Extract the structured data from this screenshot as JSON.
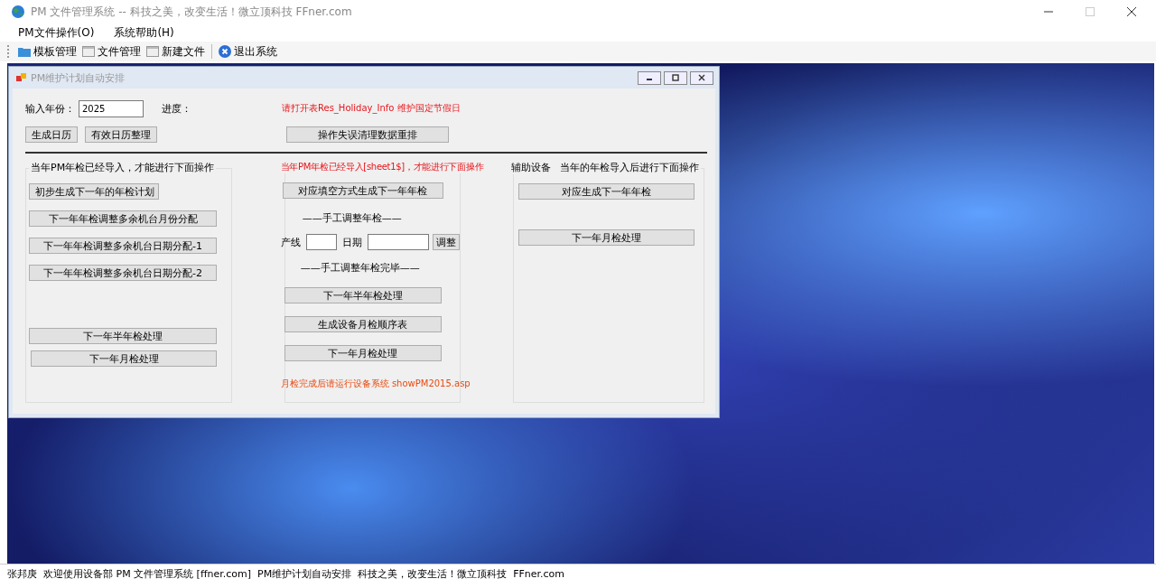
{
  "window": {
    "title": "PM 文件管理系统 -- 科技之美，改变生活！微立顶科技  FFner.com"
  },
  "menu": [
    "PM文件操作(O)",
    "系统帮助(H)"
  ],
  "toolbar": [
    {
      "label": "模板管理",
      "kind": "folder"
    },
    {
      "label": "文件管理",
      "kind": "window"
    },
    {
      "label": "新建文件",
      "kind": "window"
    },
    {
      "label": "退出系统",
      "kind": "exit"
    }
  ],
  "dialog": {
    "title": "PM维护计划自动安排",
    "year_label": "输入年份：",
    "year_value": "2025",
    "progress_label": "进度：",
    "notice": "请打开表Res_Holiday_Info 维护国定节假日",
    "calendar_buttons": [
      "生成日历",
      "有效日历整理"
    ],
    "cleanup_button": "操作失误清理数据重排",
    "left_group": {
      "title": "当年PM年检已经导入，才能进行下面操作",
      "buttons": [
        "初步生成下一年的年检计划",
        "下一年年检调整多余机台月份分配",
        "下一年年检调整多余机台日期分配-1",
        "下一年年检调整多余机台日期分配-2",
        "下一年半年检处理",
        "下一年月检处理"
      ]
    },
    "middle_group": {
      "title": "当年PM年检已经导入[sheet1$]，才能进行下面操作",
      "first_button": "对应填空方式生成下一年年检",
      "manual_start": "——手工调整年检——",
      "line_label": "产线",
      "date_label": "日期",
      "adjust_button": "调整",
      "manual_end": "——手工调整年检完毕——",
      "buttons": [
        "下一年半年检处理",
        "生成设备月检顺序表",
        "下一年月检处理"
      ],
      "footer_note": "月检完成后请运行设备系统 showPM2015.asp"
    },
    "right_group": {
      "title": "辅助设备",
      "subtitle": "当年的年检导入后进行下面操作",
      "buttons": [
        "对应生成下一年年检",
        "下一年月检处理"
      ]
    }
  },
  "status_bar": [
    "张邦庚",
    "欢迎使用设备部 PM 文件管理系统 [ffner.com]",
    "PM维护计划自动安排",
    "科技之美，改变生活！微立顶科技",
    "FFner.com"
  ]
}
